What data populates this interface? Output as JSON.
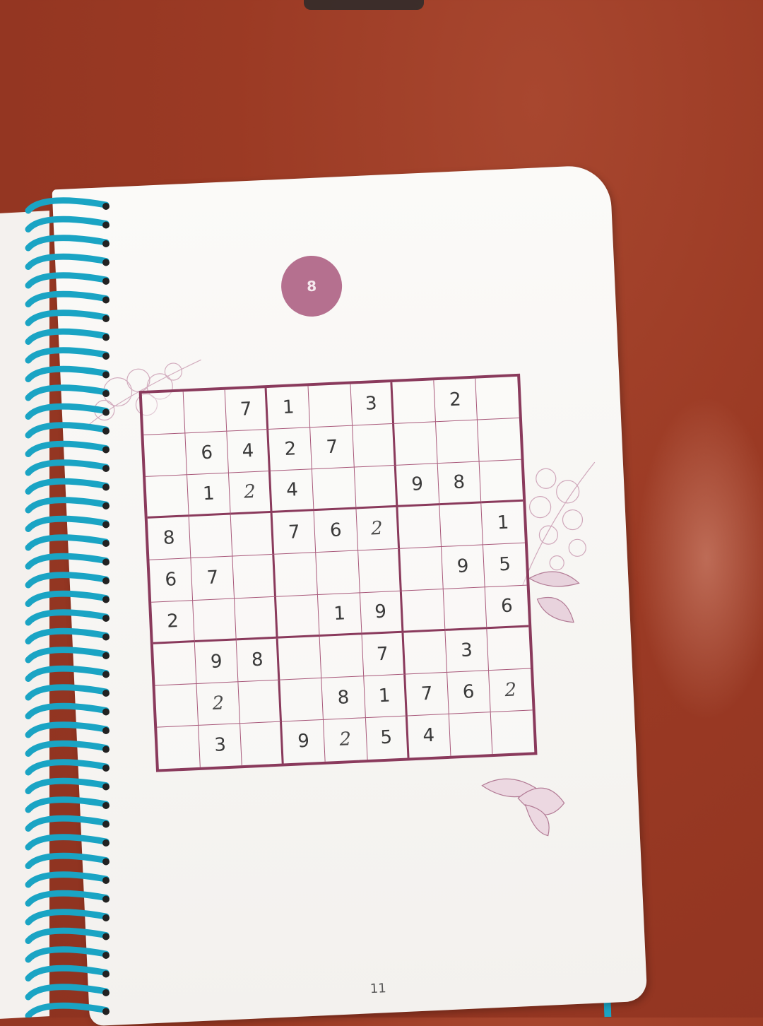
{
  "puzzle": {
    "number": "8",
    "page_number": "11",
    "grid": [
      [
        "",
        "",
        "7",
        "1",
        "",
        "3",
        "",
        "2",
        ""
      ],
      [
        "",
        "6",
        "4",
        "2",
        "7",
        "",
        "",
        "",
        ""
      ],
      [
        "",
        "1",
        "2",
        "4",
        "",
        "",
        "9",
        "8",
        ""
      ],
      [
        "8",
        "",
        "",
        "7",
        "6",
        "2",
        "",
        "",
        "1"
      ],
      [
        "6",
        "7",
        "",
        "",
        "",
        "",
        "",
        "9",
        "5"
      ],
      [
        "2",
        "",
        "",
        "",
        "1",
        "9",
        "",
        "",
        "6"
      ],
      [
        "",
        "9",
        "8",
        "",
        "",
        "7",
        "",
        "3",
        ""
      ],
      [
        "",
        "2",
        "",
        "",
        "8",
        "1",
        "7",
        "6",
        "2"
      ],
      [
        "",
        "3",
        "",
        "9",
        "2",
        "5",
        "4",
        "",
        ""
      ]
    ],
    "handwritten": [
      [
        2,
        2
      ],
      [
        3,
        5
      ],
      [
        7,
        1
      ],
      [
        7,
        8
      ],
      [
        8,
        4
      ]
    ]
  },
  "colors": {
    "grid_line": "#8a3a5c",
    "badge": "#b5708f",
    "spiral": "#1aa4c4",
    "table": "#9b3a24"
  }
}
